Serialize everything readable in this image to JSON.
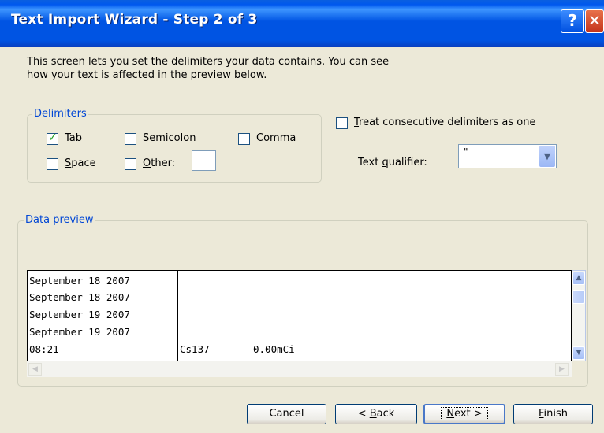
{
  "window": {
    "title": "Text Import Wizard - Step 2 of 3"
  },
  "intro": {
    "line1": "This screen lets you set the delimiters your data contains.  You can see",
    "line2": "how your text is affected in the preview below."
  },
  "delimiters": {
    "legend": "Delimiters",
    "tab": {
      "u": "T",
      "rest": "ab",
      "checked": true
    },
    "semicolon": {
      "pre": "Se",
      "u": "m",
      "rest": "icolon",
      "checked": false
    },
    "comma": {
      "u": "C",
      "rest": "omma",
      "checked": false
    },
    "space": {
      "u": "S",
      "rest": "pace",
      "checked": false
    },
    "other": {
      "u": "O",
      "rest": "ther:",
      "checked": false,
      "value": ""
    }
  },
  "consecutive": {
    "u": "T",
    "rest": "reat consecutive delimiters as one",
    "checked": false
  },
  "qualifier": {
    "label_pre": "Text ",
    "label_u": "q",
    "label_rest": "ualifier:",
    "value": "\""
  },
  "preview": {
    "legend_pre": "Data ",
    "legend_u": "p",
    "legend_rest": "review",
    "rows": [
      [
        "September 18 2007",
        "",
        ""
      ],
      [
        "September 18 2007",
        "",
        ""
      ],
      [
        "September 19 2007",
        "",
        ""
      ],
      [
        "September 19 2007",
        "",
        ""
      ],
      [
        "08:21",
        "Cs137",
        "0.00mCi"
      ]
    ]
  },
  "buttons": {
    "cancel": "Cancel",
    "back": {
      "pre": "< ",
      "u": "B",
      "rest": "ack"
    },
    "next": {
      "u": "N",
      "rest": "ext >"
    },
    "finish": {
      "u": "F",
      "rest": "inish"
    }
  },
  "colors": {
    "title_bar": "#0054e3",
    "dialog_bg": "#ece9d8",
    "group_label": "#0046d5"
  }
}
